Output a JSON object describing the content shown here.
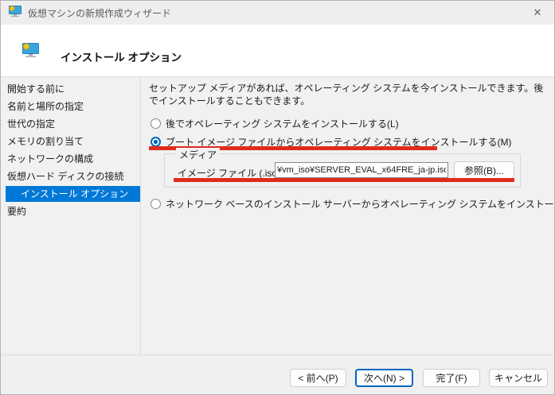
{
  "window": {
    "title": "仮想マシンの新規作成ウィザード",
    "close_label": "✕"
  },
  "header": {
    "title": "インストール オプション"
  },
  "sidebar": {
    "items": [
      {
        "label": "開始する前に",
        "selected": false
      },
      {
        "label": "名前と場所の指定",
        "selected": false
      },
      {
        "label": "世代の指定",
        "selected": false
      },
      {
        "label": "メモリの割り当て",
        "selected": false
      },
      {
        "label": "ネットワークの構成",
        "selected": false
      },
      {
        "label": "仮想ハード ディスクの接続",
        "selected": false
      },
      {
        "label": "インストール オプション",
        "selected": true
      },
      {
        "label": "要約",
        "selected": false
      }
    ]
  },
  "main": {
    "intro": "セットアップ メディアがあれば、オペレーティング システムを今インストールできます。後でインストールすることもできます。",
    "options": [
      {
        "label": "後でオペレーティング システムをインストールする(L)",
        "selected": false
      },
      {
        "label": "ブート イメージ ファイルからオペレーティング システムをインストールする(M)",
        "selected": true
      },
      {
        "label": "ネットワーク ベースのインストール サーバーからオペレーティング システムをインストールする(E)",
        "selected": false
      }
    ],
    "media_group": {
      "label": "メディア",
      "image_file_label": "イメージ ファイル (.iso)(I):",
      "image_file_value": "¥vm_iso¥SERVER_EVAL_x64FRE_ja-jp.iso",
      "browse_button": "参照(B)..."
    }
  },
  "footer": {
    "buttons": [
      {
        "label": "< 前へ(P)"
      },
      {
        "label": "次へ(N) >",
        "default": true
      },
      {
        "label": "完了(F)"
      },
      {
        "label": "キャンセル"
      }
    ]
  },
  "colors": {
    "accent": "#0078d7",
    "radio_accent": "#0067c0",
    "annotation_red": "#df2b1d",
    "titlebar_bg": "#eeeeee",
    "content_bg": "#f1f1f1"
  }
}
